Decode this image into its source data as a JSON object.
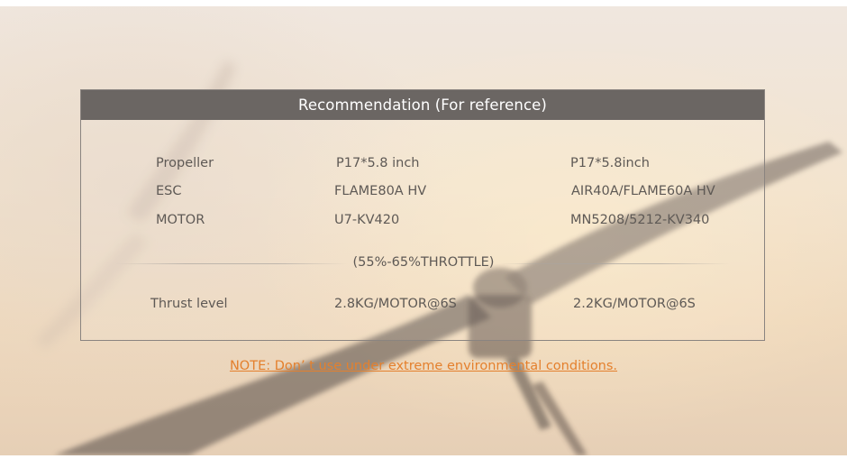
{
  "card": {
    "title": "Recommendation (For reference)",
    "rows": [
      {
        "label": "Propeller",
        "col1": "P17*5.8 inch",
        "col2": "P17*5.8inch"
      },
      {
        "label": "ESC",
        "col1": "FLAME80A HV",
        "col2": "AIR40A/FLAME60A HV"
      },
      {
        "label": "MOTOR",
        "col1": "U7-KV420",
        "col2": "MN5208/5212-KV340"
      }
    ],
    "throttle": "(55%-65%THROTTLE)",
    "thrust": {
      "label": "Thrust level",
      "col1": "2.8KG/MOTOR@6S",
      "col2": "2.2KG/MOTOR@6S"
    }
  },
  "note": "NOTE: Don’ t use under extreme environmental conditions.",
  "colors": {
    "header_bg": "#6b6663",
    "note": "#e4802d",
    "text": "#5e5955"
  }
}
